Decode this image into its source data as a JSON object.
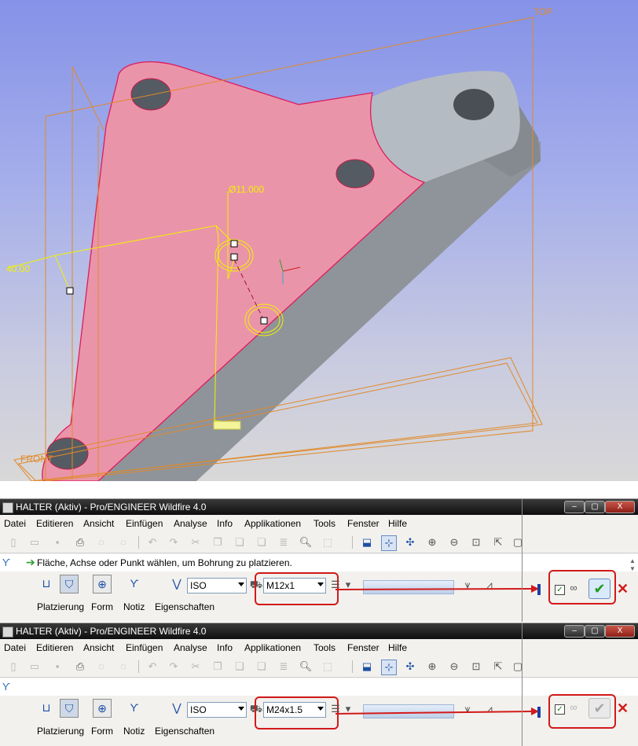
{
  "viewport": {
    "datum_top": "TOP",
    "datum_front": "FRONT",
    "dim_diameter": "Ø11.000",
    "dim_offset": "40.00"
  },
  "panes": [
    {
      "title": "HALTER (Aktiv) - Pro/ENGINEER Wildfire 4.0",
      "message": "Fläche, Achse oder Punkt wählen, um Bohrung zu platzieren.",
      "standard": "ISO",
      "thread_size": "M12x1",
      "ok_enabled": true
    },
    {
      "title": "HALTER (Aktiv) - Pro/ENGINEER Wildfire 4.0",
      "message": "",
      "standard": "ISO",
      "thread_size": "M24x1.5",
      "ok_enabled": false
    }
  ],
  "menu": [
    "Datei",
    "Editieren",
    "Ansicht",
    "Einfügen",
    "Analyse",
    "Info",
    "Applikationen",
    "Tools",
    "Fenster",
    "Hilfe"
  ],
  "dashboard_tabs": [
    "Platzierung",
    "Form",
    "Notiz",
    "Eigenschaften"
  ],
  "window_buttons": {
    "minimize": "–",
    "maximize": "▢",
    "close": "X"
  },
  "icons": {
    "hole": "hole-icon",
    "ok": "checkmark-icon",
    "cancel": "cancel-x-icon",
    "preview": "glasses-icon",
    "message_arrow": "green-arrow-icon"
  },
  "colors": {
    "part_face": "#ea94aa",
    "part_side": "#8f949a",
    "datum_plane": "#e08a2a",
    "dimension": "#f2f200",
    "annotation_red": "#d21a1a",
    "title_bar": "#1a1a1a",
    "ok_green": "#1f9a1f"
  }
}
